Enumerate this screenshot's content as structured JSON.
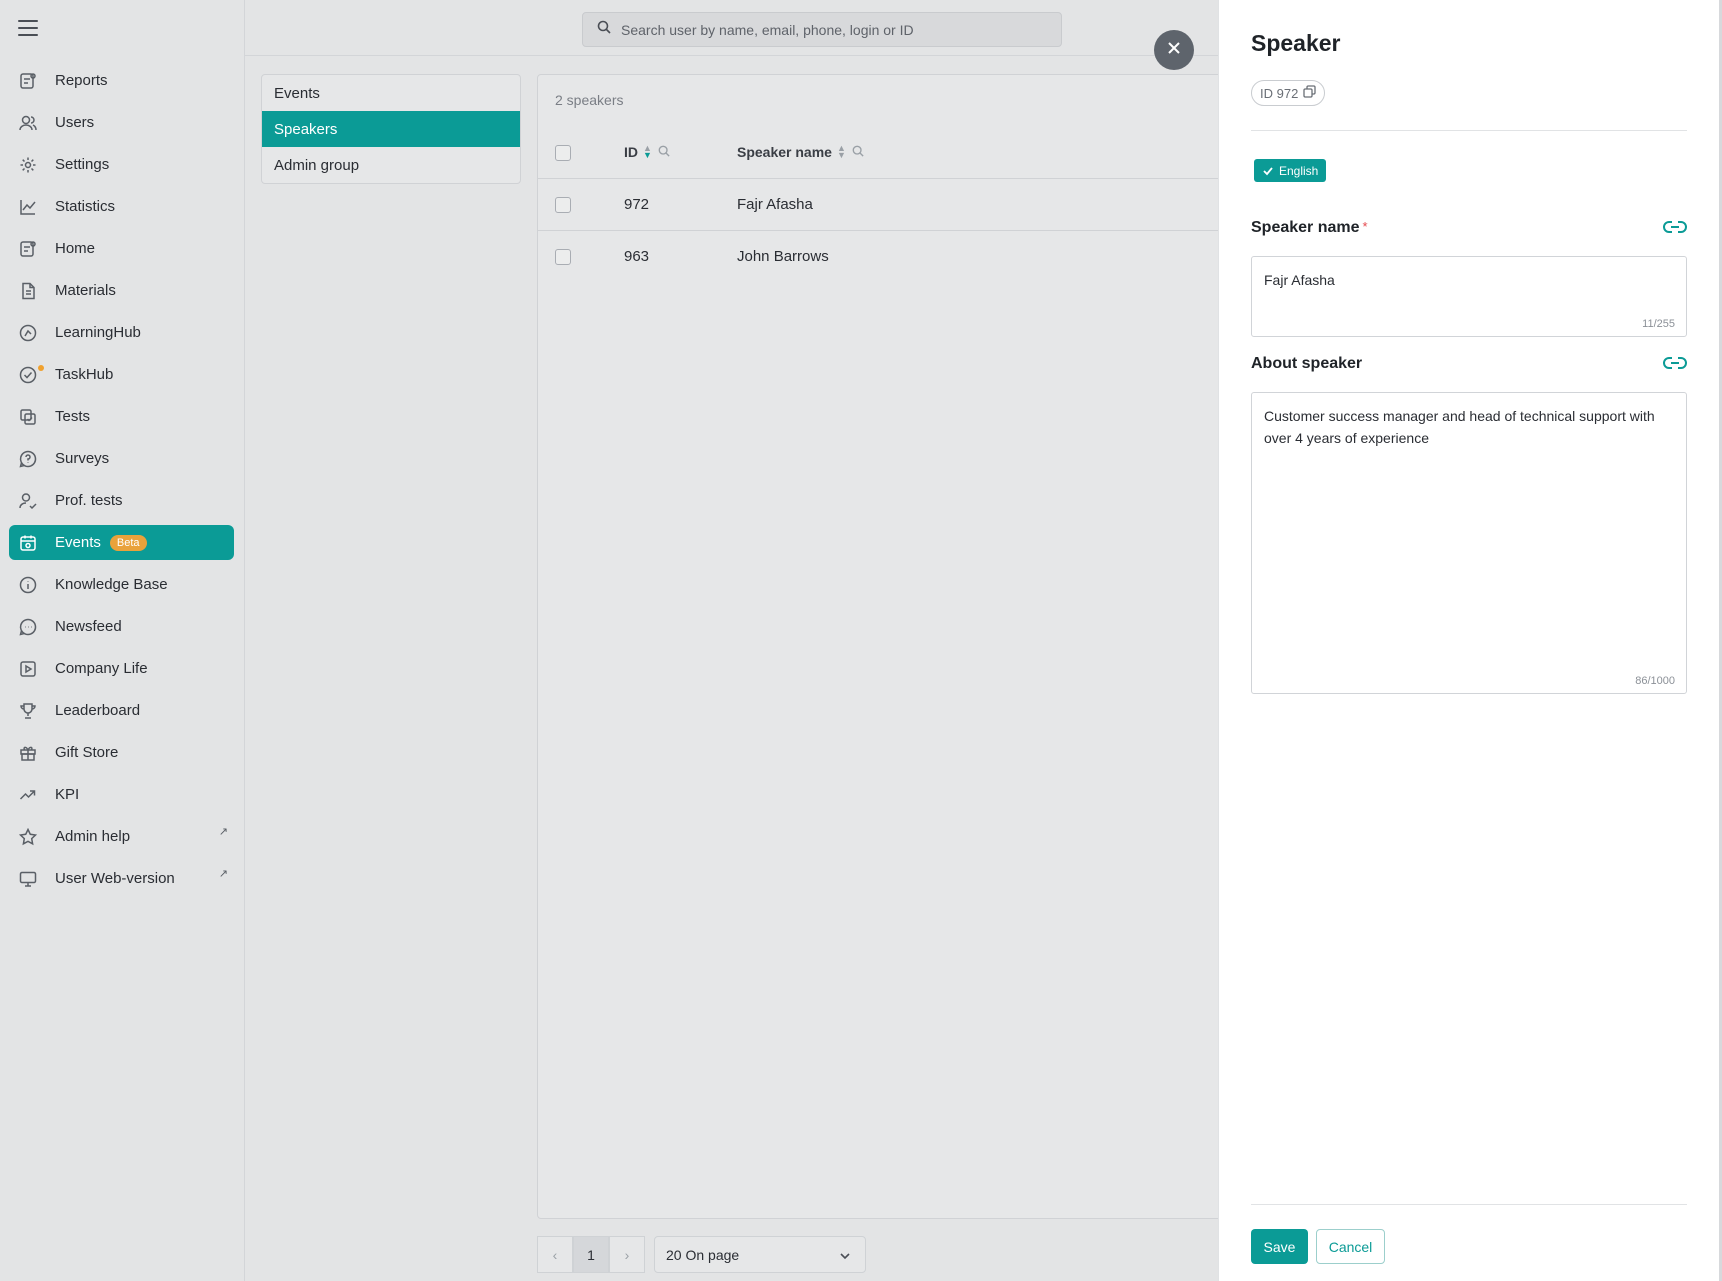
{
  "search": {
    "placeholder": "Search user by name, email, phone, login or ID"
  },
  "sidebar": {
    "items": [
      {
        "label": "Reports",
        "icon": "reports-icon"
      },
      {
        "label": "Users",
        "icon": "users-icon"
      },
      {
        "label": "Settings",
        "icon": "gear-icon"
      },
      {
        "label": "Statistics",
        "icon": "chart-line-icon"
      },
      {
        "label": "Home",
        "icon": "home-icon"
      },
      {
        "label": "Materials",
        "icon": "document-icon"
      },
      {
        "label": "LearningHub",
        "icon": "learninghub-icon"
      },
      {
        "label": "TaskHub",
        "icon": "taskhub-icon"
      },
      {
        "label": "Tests",
        "icon": "tests-icon"
      },
      {
        "label": "Surveys",
        "icon": "surveys-icon"
      },
      {
        "label": "Prof. tests",
        "icon": "user-check-icon"
      },
      {
        "label": "Events",
        "icon": "calendar-icon",
        "badge": "Beta",
        "active": true
      },
      {
        "label": "Knowledge Base",
        "icon": "info-icon"
      },
      {
        "label": "Newsfeed",
        "icon": "chat-icon"
      },
      {
        "label": "Company Life",
        "icon": "play-icon"
      },
      {
        "label": "Leaderboard",
        "icon": "trophy-icon"
      },
      {
        "label": "Gift Store",
        "icon": "gift-icon"
      },
      {
        "label": "KPI",
        "icon": "trend-icon"
      },
      {
        "label": "Admin help",
        "icon": "star-icon"
      },
      {
        "label": "User Web-version",
        "icon": "monitor-icon"
      }
    ]
  },
  "subnav": {
    "items": [
      "Events",
      "Speakers",
      "Admin group"
    ]
  },
  "table": {
    "count": "2 speakers",
    "columns": [
      "ID",
      "Speaker name"
    ],
    "rows": [
      {
        "id": "972",
        "name": "Fajr Afasha"
      },
      {
        "id": "963",
        "name": "John Barrows"
      }
    ]
  },
  "pagination": {
    "page": "1",
    "per_page": "20 On page"
  },
  "drawer": {
    "title": "Speaker",
    "id_chip": "ID 972",
    "language": "English",
    "speaker_name_label": "Speaker name",
    "speaker_name_required": "*",
    "speaker_name_value": "Fajr Afasha",
    "speaker_name_counter": "11/255",
    "about_label": "About speaker",
    "about_value": "Customer success manager and head of technical support with over 4 years of experience",
    "about_counter": "86/1000",
    "save_label": "Save",
    "cancel_label": "Cancel"
  },
  "colors": {
    "accent": "#0b9b96",
    "badge": "#e9a23b",
    "backdrop": "#e3e4e5"
  }
}
